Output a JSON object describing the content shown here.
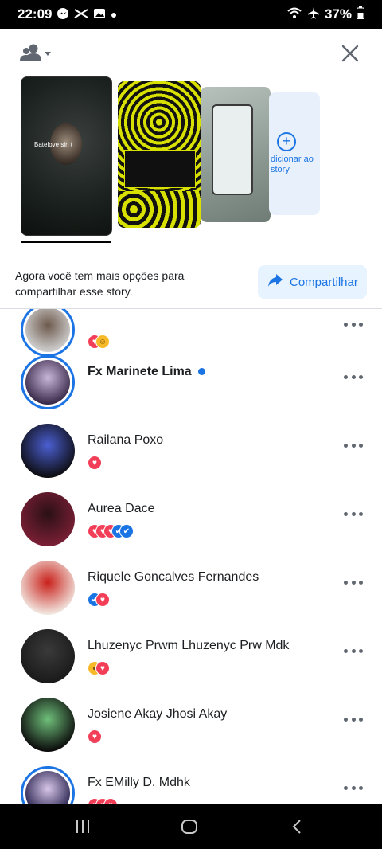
{
  "status_bar": {
    "time": "22:09",
    "battery": "37%",
    "icons": [
      "messenger-icon",
      "capcut-icon",
      "gallery-icon",
      "dot-icon",
      "wifi-icon",
      "airplane-icon",
      "battery-icon"
    ]
  },
  "header": {
    "audience_icon": "people-icon",
    "close_icon": "close-icon"
  },
  "stories": {
    "add_label": "dicionar ao story",
    "cards": [
      {
        "name": "story-card-1",
        "overlay_text": "Batelove sin t"
      },
      {
        "name": "story-card-2"
      },
      {
        "name": "story-card-3"
      }
    ]
  },
  "share": {
    "message": "Agora você tem mais opções para compartilhar esse story.",
    "button_label": "Compartilhar"
  },
  "viewers": [
    {
      "name": "",
      "reactions": [
        "love",
        "haha"
      ],
      "ring": true,
      "colors": [
        "#cfcfcf",
        "#6e5a4d"
      ]
    },
    {
      "name": "Fx Marinete Lima",
      "bold": true,
      "verified_dot": true,
      "reactions": [],
      "ring": true,
      "colors": [
        "#3a2a4a",
        "#c8b6d8"
      ]
    },
    {
      "name": "Railana Poxo",
      "reactions": [
        "love"
      ],
      "ring": false,
      "colors": [
        "#0d0d12",
        "#4b5fd1"
      ]
    },
    {
      "name": "Aurea Dace",
      "reactions": [
        "love",
        "love",
        "love",
        "like",
        "like"
      ],
      "ring": false,
      "colors": [
        "#7a1f35",
        "#2a1015"
      ]
    },
    {
      "name": "Riquele Goncalves Fernandes",
      "reactions": [
        "like",
        "love"
      ],
      "ring": false,
      "colors": [
        "#f1e6df",
        "#c9211b"
      ]
    },
    {
      "name": "Lhuzenyc Prwm Lhuzenyc Prw Mdk",
      "reactions": [
        "wow",
        "love"
      ],
      "ring": false,
      "colors": [
        "#1a1a1a",
        "#3a3a3a"
      ]
    },
    {
      "name": "Josiene Akay Jhosi Akay",
      "reactions": [
        "love"
      ],
      "ring": false,
      "colors": [
        "#0b0b0b",
        "#6fbf7a"
      ]
    },
    {
      "name": "Fx EMilly D. Mdhk",
      "reactions": [
        "love",
        "love",
        "love"
      ],
      "ring": true,
      "colors": [
        "#2a2450",
        "#d7c6e8"
      ]
    }
  ],
  "nav_bar": {
    "recents_icon": "recents-icon",
    "home_icon": "home-icon",
    "back_icon": "back-icon"
  }
}
